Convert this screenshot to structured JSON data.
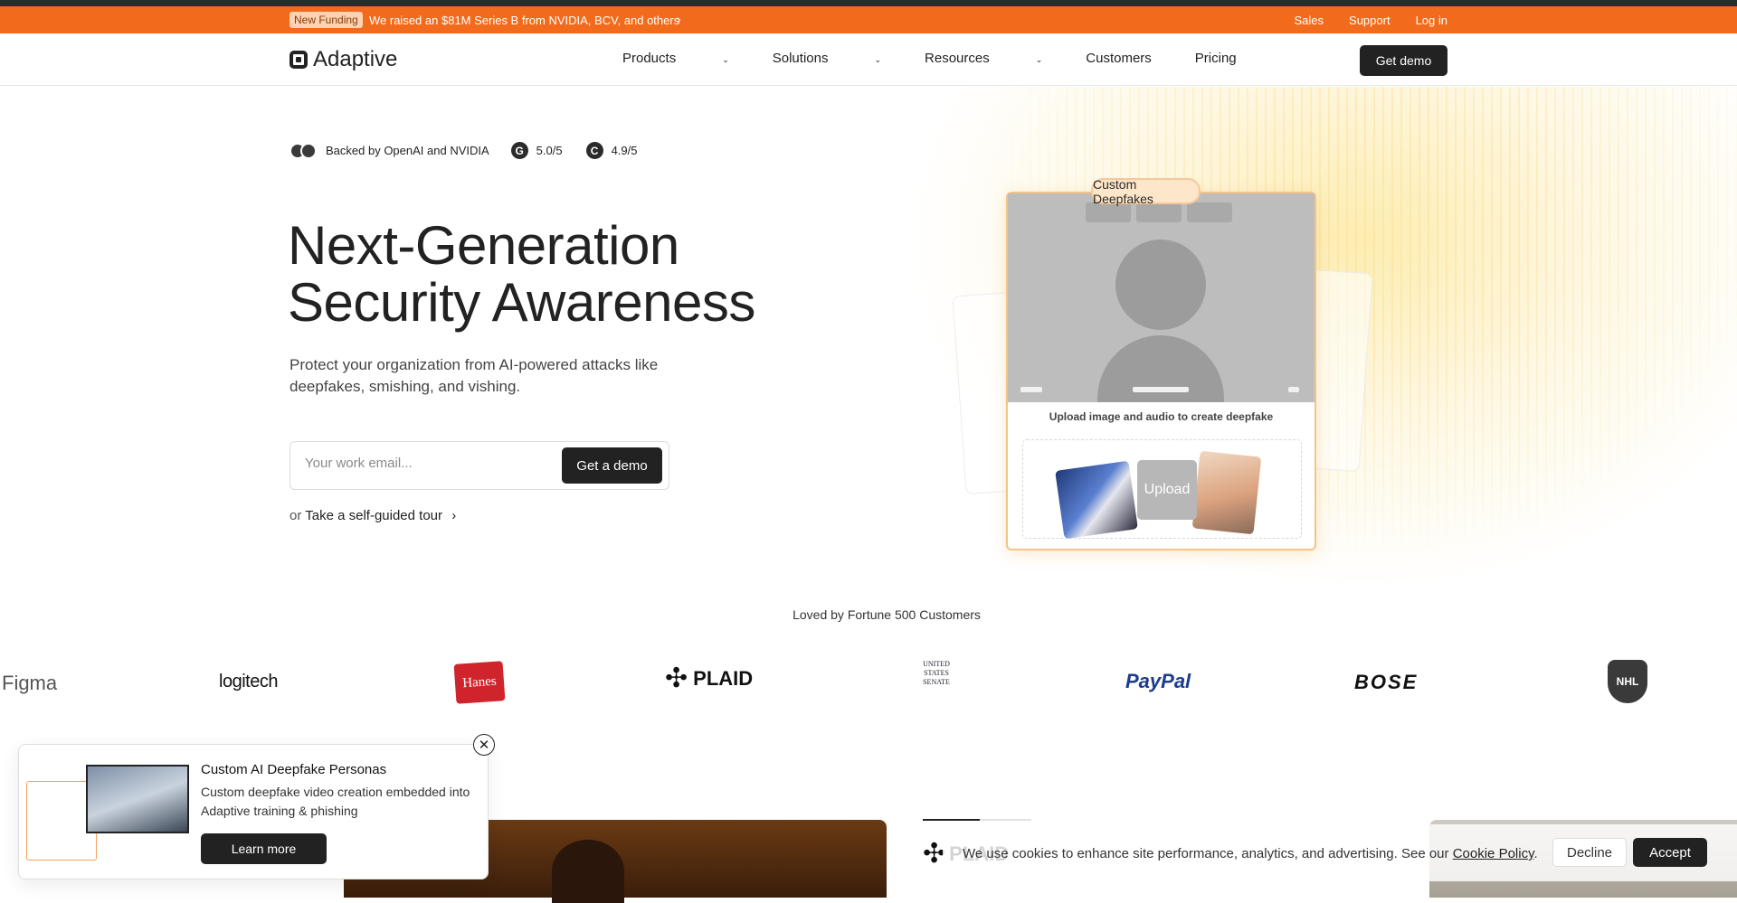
{
  "banner": {
    "badge": "New Funding",
    "message": "We raised an $81M Series B from NVIDIA, BCV, and others",
    "links": [
      "Sales",
      "Support",
      "Log in"
    ]
  },
  "nav": {
    "brand": "Adaptive",
    "items": [
      "Products",
      "Solutions",
      "Resources",
      "Customers",
      "Pricing"
    ],
    "cta": "Get demo"
  },
  "hero": {
    "backed": "Backed by OpenAI and NVIDIA",
    "rating1": "5.0/5",
    "rating2": "4.9/5",
    "title_line1": "Next-Generation",
    "title_line2": "Security Awareness",
    "subtitle": "Protect your organization from AI-powered attacks like deepfakes, smishing, and vishing.",
    "email_placeholder": "Your work email...",
    "demo_button": "Get a demo",
    "tour_prefix": "or",
    "tour_link": "Take a self-guided tour"
  },
  "feature_card": {
    "tag": "Custom Deepfakes",
    "upload_label": "Upload image and audio to create deepfake",
    "upload_button": "Upload"
  },
  "customers": {
    "heading": "Loved by Fortune 500 Customers",
    "logos": [
      "Figma",
      "logitech",
      "Hanes",
      "PLAID",
      "UNITED STATES SENATE",
      "PayPal",
      "BOSE",
      "NHL"
    ]
  },
  "popup": {
    "title": "Custom AI Deepfake Personas",
    "description": "Custom deepfake video creation embedded into Adaptive training & phishing",
    "button": "Learn more"
  },
  "cookie": {
    "text": "We use cookies to enhance site performance, analytics, and advertising. See our",
    "policy_link": "Cookie Policy",
    "decline": "Decline",
    "accept": "Accept"
  },
  "colors": {
    "banner": "#f26b1d",
    "primary": "#222222",
    "card_border": "#f4c486"
  }
}
